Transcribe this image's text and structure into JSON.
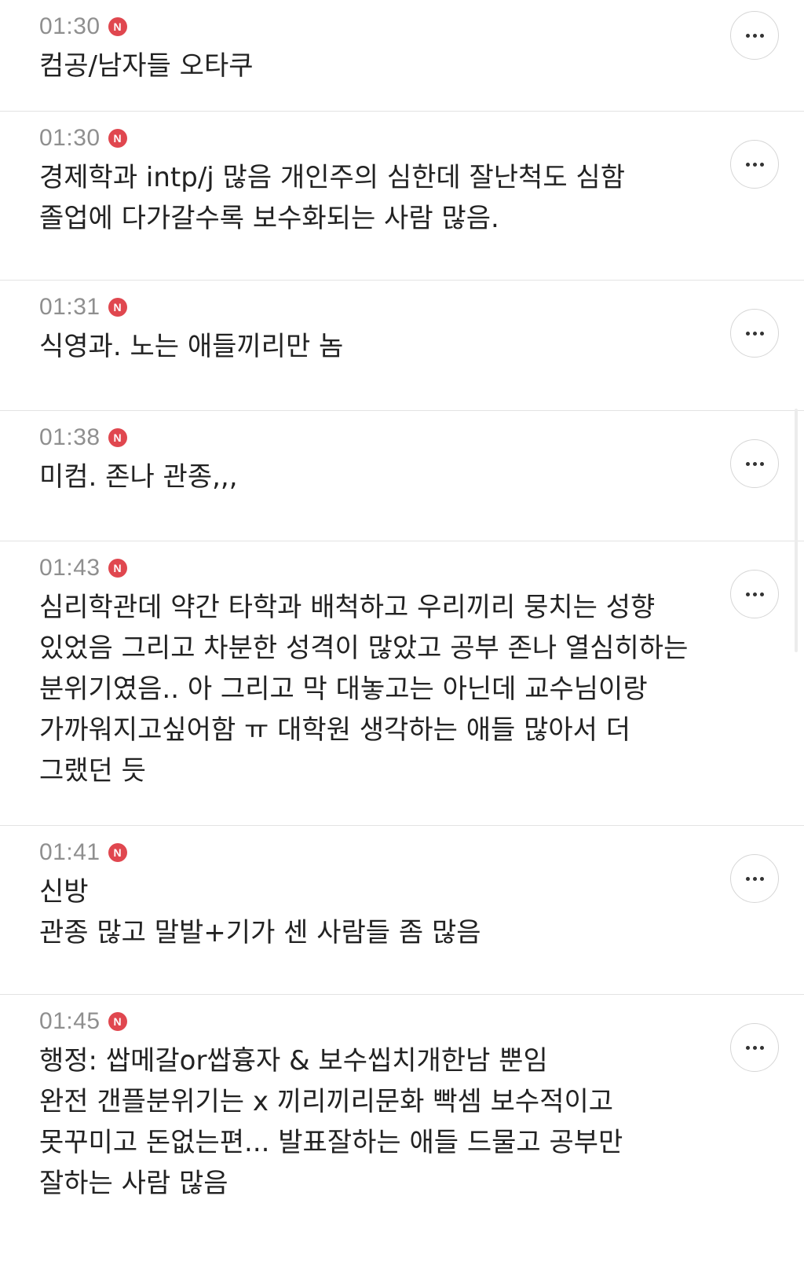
{
  "badge_label": "N",
  "colors": {
    "badge": "#e0474f",
    "time": "#8f8f8f",
    "text": "#222222",
    "divider": "#e3e3e3"
  },
  "comments": [
    {
      "time": "01:30",
      "text": "컴공/남자들 오타쿠"
    },
    {
      "time": "01:30",
      "text": "경제학과 intp/j 많음 개인주의 심한데 잘난척도 심함\n졸업에 다가갈수록 보수화되는 사람 많음."
    },
    {
      "time": "01:31",
      "text": "식영과. 노는 애들끼리만 놈"
    },
    {
      "time": "01:38",
      "text": "미컴. 존나 관종,,,"
    },
    {
      "time": "01:43",
      "text": "심리학관데 약간 타학과 배척하고 우리끼리 뭉치는 성향 있었음 그리고 차분한 성격이 많았고 공부 존나 열심히하는 분위기였음.. 아 그리고 막 대놓고는 아닌데 교수님이랑 가까워지고싶어함 ㅠ 대학원 생각하는 애들 많아서 더 그랬던 듯"
    },
    {
      "time": "01:41",
      "text": "신방\n관종 많고 말발+기가 센 사람들 좀 많음"
    },
    {
      "time": "01:45",
      "text": "행정: 쌉메갈or쌉흉자 & 보수씹치개한남 뿐임\n완전 갠플분위기는 x 끼리끼리문화 빡셈 보수적이고 못꾸미고 돈없는편... 발표잘하는 애들 드물고 공부만 잘하는 사람 많음"
    }
  ]
}
